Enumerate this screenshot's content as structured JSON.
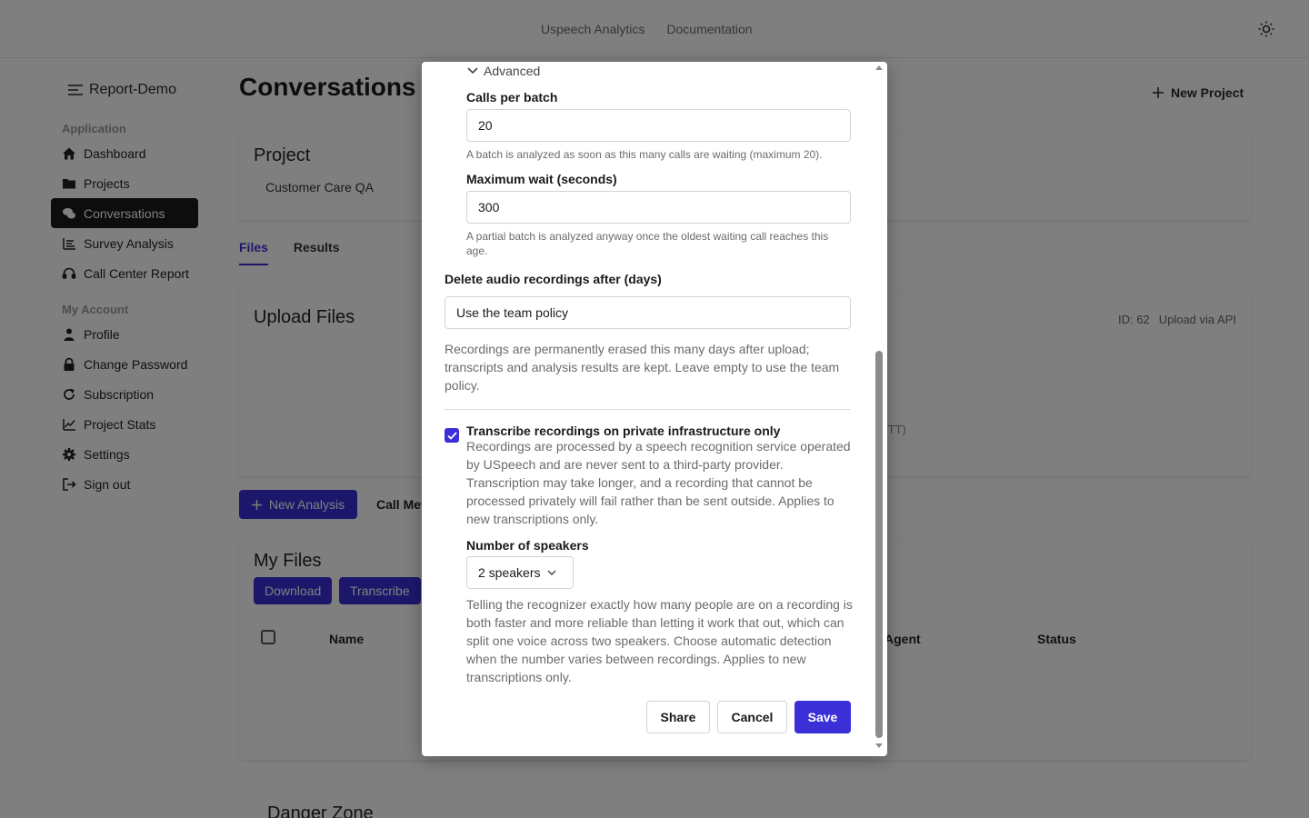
{
  "topbar": {
    "links": [
      "Uspeech Analytics",
      "Documentation"
    ],
    "theme_icon": "sun-icon"
  },
  "sidebar": {
    "brand": "Report-Demo",
    "sections": [
      {
        "title": "Application",
        "items": [
          {
            "label": "Dashboard",
            "icon": "home-icon",
            "active": false
          },
          {
            "label": "Projects",
            "icon": "folder-icon",
            "active": false
          },
          {
            "label": "Conversations",
            "icon": "chat-icon",
            "active": true
          },
          {
            "label": "Survey Analysis",
            "icon": "list-icon",
            "active": false
          },
          {
            "label": "Call Center Report",
            "icon": "headset-icon",
            "active": false
          }
        ]
      },
      {
        "title": "My Account",
        "items": [
          {
            "label": "Profile",
            "icon": "user-icon",
            "active": false
          },
          {
            "label": "Change Password",
            "icon": "lock-icon",
            "active": false
          },
          {
            "label": "Subscription",
            "icon": "refresh-icon",
            "active": false
          },
          {
            "label": "Project Stats",
            "icon": "chart-icon",
            "active": false
          },
          {
            "label": "Settings",
            "icon": "gear-icon",
            "active": false
          },
          {
            "label": "Sign out",
            "icon": "sign-out-icon",
            "active": false
          }
        ]
      }
    ]
  },
  "main": {
    "title": "Conversations",
    "new_project": "New Project",
    "project_heading": "Project",
    "project_name": "Customer Care QA",
    "tabs": [
      "Files",
      "Results"
    ],
    "upload_heading": "Upload Files",
    "upload_id": "ID: 62",
    "upload_api": "Upload via API",
    "upload_formats_fragment": "VTT)",
    "new_analysis": "New Analysis",
    "call_met_fragment": "Call Met",
    "files_heading": "My Files",
    "download": "Download",
    "transcribe": "Transcribe",
    "columns": [
      "Name",
      "Agent",
      "Status"
    ],
    "danger_zone": "Danger Zone"
  },
  "modal": {
    "advanced": "Advanced",
    "calls_per_batch": {
      "label": "Calls per batch",
      "value": "20",
      "help": "A batch is analyzed as soon as this many calls are waiting (maximum 20)."
    },
    "max_wait": {
      "label": "Maximum wait (seconds)",
      "value": "300",
      "help": "A partial batch is analyzed anyway once the oldest waiting call reaches this age."
    },
    "delete_audio": {
      "label": "Delete audio recordings after (days)",
      "placeholder": "Use the team policy",
      "help": "Recordings are permanently erased this many days after upload; transcripts and analysis results are kept. Leave empty to use the team policy."
    },
    "private_transcribe": {
      "checked": true,
      "label": "Transcribe recordings on private infrastructure only",
      "help": "Recordings are processed by a speech recognition service operated by USpeech and are never sent to a third-party provider. Transcription may take longer, and a recording that cannot be processed privately will fail rather than be sent outside. Applies to new transcriptions only."
    },
    "speakers": {
      "label": "Number of speakers",
      "value": "2 speakers",
      "help": "Telling the recognizer exactly how many people are on a recording is both faster and more reliable than letting it work that out, which can split one voice across two speakers. Choose automatic detection when the number varies between recordings. Applies to new transcriptions only."
    },
    "buttons": {
      "share": "Share",
      "cancel": "Cancel",
      "save": "Save"
    }
  },
  "colors": {
    "accent": "#3b2fd8",
    "sidebar_active": "#1a1a1a",
    "overlay": "rgba(0,0,0,0.5)"
  }
}
